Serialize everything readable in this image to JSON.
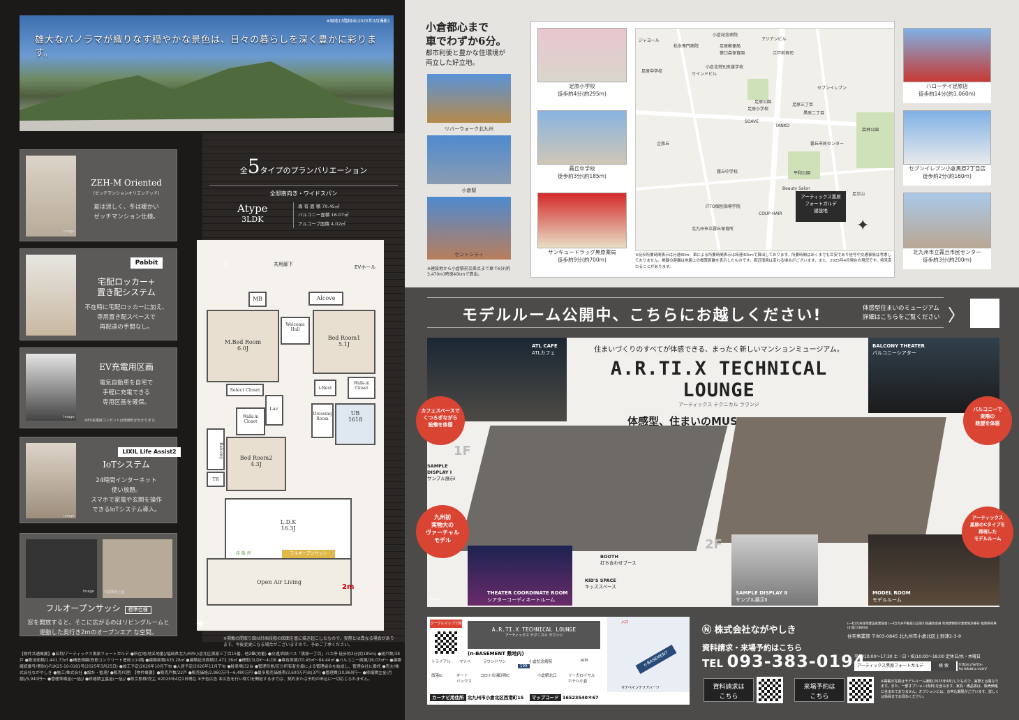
{
  "hero": {
    "caption": "雄大なパノラマが織りなす穏やかな景色は、日々の暮らしを深く豊かに彩ります。",
    "photo_note": "※現地13階相当(2025年3月撮影)"
  },
  "features": [
    {
      "title1": "ZEH-M Oriented",
      "title2": "(ゼッチマンションオリエンテッド)",
      "desc": [
        "夏は涼しく、冬は暖かい",
        "ゼッチマンション仕様。"
      ],
      "cap": "Image"
    },
    {
      "logo": "Pabbit",
      "title": "宅配ロッカー+\n置き配システム",
      "desc": [
        "不在時に宅配ロッカーに加え、",
        "専用置き配スペースで",
        "再配達の手間なし。"
      ]
    },
    {
      "title": "EV充電用区画",
      "desc": [
        "電気自動車を自宅で",
        "手軽に充電できる",
        "専用区画を確保。"
      ],
      "cap": "Image",
      "note": "※EV充電用コンセントは使用料がかかります。"
    },
    {
      "logo": "LIXIL Life Assist2",
      "title": "IoTシステム",
      "desc": [
        "24時間インターネット",
        "使い放題。",
        "スマホで家電や玄関を操作",
        "できるIoTシステム導入。"
      ],
      "cap": "Image"
    },
    {
      "title": "フルオープンサッシ",
      "badge": "標準仕様",
      "desc": [
        "窓を開放すると、そこに広がるのはリビングルームと",
        "連動した奥行き2mのオープンエア な空間。"
      ],
      "cap": "Image",
      "cap2": "※開放時上面"
    }
  ],
  "plan": {
    "intro_pre": "全",
    "intro_num": "5",
    "intro_post": "タイプのプランバリエーション",
    "sub": "全邸南向き・ワイドスパン",
    "type": "Atype",
    "ldk": "3LDK",
    "specs": [
      "専 有 面 積  70.45㎡",
      "バルコニー面積  16.07㎡",
      "アルコーブ面積  4.02㎡"
    ],
    "rooms": {
      "hall": "共用廊下",
      "ev": "EVホール",
      "mb": "MB",
      "alcove": "Alcove",
      "welcome": "Welcome\nHall",
      "mbed": "M.Bed Room\n6.0J",
      "bed1": "Bed Room1\n5.1J",
      "select": "Select Closet",
      "walkin1": "Walk-in\nCloset",
      "lav": "Lav.",
      "irest": "i-Rest",
      "walkin2": "Walk-in\nCloset",
      "dress": "Dressing\nRoom",
      "ub": "UB\n1618",
      "bed2": "Bed Room2\n4.3J",
      "balcony": "Balcony",
      "tr": "TR",
      "ldk": "L.D.K\n16.3J",
      "floor": "床 暖 房",
      "sash": "フルオープンサッシ",
      "open": "Open Air Living",
      "two": "2m",
      "light": "光"
    },
    "note": "※掲載の間取り図は計画段階の図面を基に描き起こしたもので、実際とは異なる場合があります。今後変更になる場合がございますので、予めご了承ください。"
  },
  "legal": "【物件共通概要】●名称/アーティックス黒原フォートガルデ ●所在地(地名地番)/福岡県北九州市小倉北区黒原三丁目15番、他2筆(地番) ●交通/西鉄バス「黒原一丁目」バス停 徒歩約3分(約185m) ●総戸数/38戸 ●敷地面積/1,441.73㎡ ●構造規模/鉄筋コンクリート造地上14階 ●建築面積/435.28㎡ ●建築延床面積/2,472.36㎡ ●間取/3LDK～4LDK ●専有面積/70.45㎡～84.44㎡ ●バルコニー面積/16.07㎡～ ●建築確認番号/第BVJ-FUK25-10-0181号(2025年3月25日) ●竣工予定/2026年10月下旬 ●入居予定/2026年11月下旬 ●駐車場/32台 ●管理形態/区分所有者全員による管理組合を結成し、管理会社に委託 ●売主/株式会社ながやしき ●施工/株式会社 ●設計・監理/ ●販売代理/ 【物件概要】●販売戸数/22戸 ●販売価格/2,860万円～6,480万円 ●最多販売価格帯/3,600万円台(3戸) ●管理費/10,860円～ ●修繕積立金(月額)/5,940円～ ●管理準備金(一括)/ ●修繕積立基金(一括)/ ●取引態様/売主 ※2025年4月1日現在 ※予告広告 本広告を行い取引を開始するまでは、契約または予約の申込に一切応じられません。",
  "access": {
    "head": [
      "小倉都心まで",
      "車でわずか6分。"
    ],
    "sub": [
      "都市利便と豊かな住環境が",
      "両立した好立地。"
    ],
    "landmarks": [
      "リバーウォーク北九州",
      "小倉駅",
      "セントシティ"
    ],
    "note": "※建設地から小倉駅前交差点まで車で6分(約3,470m)時速40kmで算出。"
  },
  "map_photos": [
    {
      "name": "足原小学校",
      "walk": "徒歩約4分(約295m)"
    },
    {
      "name": "霧丘中学校",
      "walk": "徒歩約3分(約185m)"
    },
    {
      "name": "サンキュードラッグ黒原薬局",
      "walk": "徒歩約9分(約700m)"
    },
    {
      "name": "ハローデイ足原店",
      "walk": "徒歩約14分(約1,060m)"
    },
    {
      "name": "セブンイレブン小倉黒原2丁目店",
      "walk": "徒歩約2分(約160m)"
    },
    {
      "name": "北九州市立霧丘市民センター",
      "walk": "徒歩約3分(約200m)"
    }
  ],
  "map": {
    "site": "アーティックス黒原\nフォートガルデ\n建設地",
    "labels": [
      "小倉記念病院",
      "アジアンビル",
      "松永専門病院",
      "足原郵便局",
      "蓑口森保育園",
      "足原小学校",
      "江戸前寿司",
      "足原公園",
      "ジャヨール",
      "足原中学校",
      "小倉北特別支援学校",
      "黒原二丁目",
      "森林公園",
      "霧丘中学校",
      "平和公園",
      "足原三丁目",
      "TANKO",
      "SOAVE",
      "Beauty Salon",
      "COUP-HAIR",
      "アーティックス黒原フォートガルデ",
      "霧丘市民センター",
      "ITTO個別指導学院",
      "北九州市立霧丘保育所",
      "セブンイレブン",
      "ウインドビル",
      "足立山",
      "企救丘"
    ],
    "note": "※徒歩所要時間表示は分速80m、車による所要時間表示は時速40kmで算出しております。所要時間はあくまでも目安であり信号や交通事情は考慮しておりません。掲載の距離は地図上の概算距離を表示したものです。周辺環境は変わる場合がございます。また、2025年4月現在の現況です。将来変わることがあります。"
  },
  "banner": {
    "main": "モデルルーム公開中、こちらにお越しください!",
    "side": [
      "体感型住まいのミュージアム",
      "詳細はこちらをご覧ください"
    ]
  },
  "lounge": {
    "intro": "住まいづくりのすべてが体感できる、まったく新しいマンションミュージアム。",
    "title": "A.R.TI.X TECHNICAL LOUNGE",
    "kana": "アーティックス テクニカル ラウンジ",
    "tagline": "体感型、住まいのMUSEUM OPEN。",
    "cafe": "ATL CAFE",
    "cafe_kana": "ATLカフェ",
    "balcony": "BALCONY THEATER",
    "balcony_kana": "バルコニーシアター",
    "c1": "カフェスペースで\nくつろぎながら\n設備を体感",
    "c2": "九州初\n実物大の\nヴァーチャル\nモデル",
    "c3": "バルコニーで\n実際の\n眺望を体感",
    "c4": "アーティックス\n黒原のCタイプを\n再現した\nモデルルーム",
    "sample1": "SAMPLE\nDISPLAY Ⅰ",
    "sample1_kana": "サンプル展示Ⅰ",
    "booth": "BOOTH",
    "booth_kana": "打ち合わせブース",
    "kids": "KID'S SPACE",
    "kids_kana": "キッズスペース",
    "theater": "THEATER COORDINATE ROOM",
    "theater_kana": "シアターコーディネートルーム",
    "sample2": "SAMPLE DISPLAY Ⅱ",
    "sample2_kana": "サンプル展示Ⅱ",
    "model": "MODEL ROOM",
    "model_kana": "モデルルーム",
    "f1": "1F",
    "f2": "2F",
    "image": "Image"
  },
  "bottom_map": {
    "title": "A.R.TI.X TECHNICAL LOUNGE",
    "kana": "アーティックス テクニカル ラウンジ",
    "basement": "(n-BASEMENT 敷地内)",
    "qr_label": "グーグルマップで検索",
    "labels": [
      "トライアル",
      "マナベ",
      "ラウンドワン",
      "小倉記念病院",
      "AIM",
      "西港IC",
      "オート\nバックス",
      "コロナの湯",
      "日明IC",
      "小倉駅北口",
      "リーガロイヤル\nホテル小倉",
      "n-BASEMENT",
      "マナベインテリアハーツ",
      "入口"
    ],
    "road": "199",
    "nav": "カーナビ用住所",
    "address": "北九州市小倉北区西港町15",
    "mapcode_l": "マップコード",
    "mapcode": "16523540＊67"
  },
  "company": {
    "name": "株式会社ながやしき",
    "assoc": "(一社)九州住宅建設産業協会 (一社)九州不動産公正取引協議会会員 宅地建物取引業者免許番号 福岡県知事(4)第15884号",
    "office": "住宅事業部 〒803-0845 北九州市小倉北区上到津2-3-9",
    "request": "資料請求・来場予約はこちら",
    "tel_l": "TEL",
    "tel": "093-383-0194",
    "hours": [
      "平日/10:00～17:30 土・日・祝/10:00～18:00 定休日/水・木曜日"
    ],
    "search": "アーティックス黒原フォートガルデ",
    "search_btn": "検 索",
    "url": "https://artix-kurobaru.com/",
    "btn1": "資料請求は\nこちら",
    "btn2": "来場予約は\nこちら",
    "note": "※掲載の写真はモデルルーム撮影(2025年4月)したもので、実際とは異なります。また、一部オプション(有料)を含みます。家具・備品等は、販売価格に含まれておりません。オプションには、お申込期限がございます。詳しくは係員までお尋ねください。"
  }
}
